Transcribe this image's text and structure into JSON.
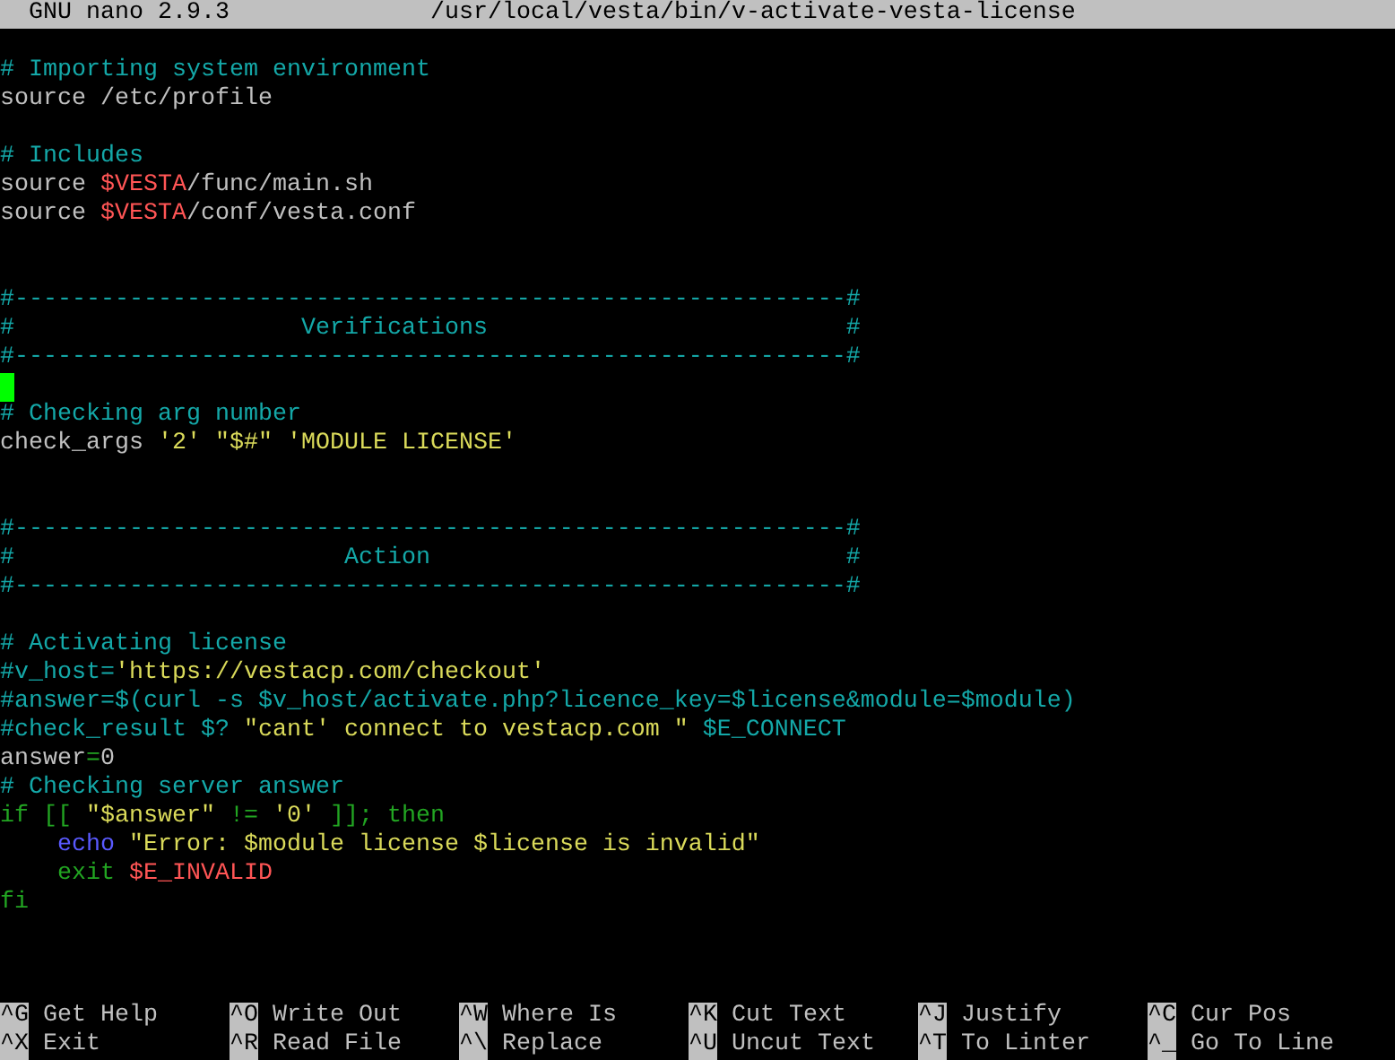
{
  "title_bar": {
    "app": "GNU nano 2.9.3",
    "file": "/usr/local/vesta/bin/v-activate-vesta-license"
  },
  "lines": [
    {
      "kind": "blank"
    },
    {
      "kind": "code",
      "segments": [
        {
          "text": "# Importing system environment",
          "kind": "comment"
        }
      ]
    },
    {
      "kind": "code",
      "segments": [
        {
          "text": "source /etc/profile",
          "kind": "plain"
        }
      ]
    },
    {
      "kind": "blank"
    },
    {
      "kind": "code",
      "segments": [
        {
          "text": "# Includes",
          "kind": "comment"
        }
      ]
    },
    {
      "kind": "code",
      "segments": [
        {
          "text": "source ",
          "kind": "plain"
        },
        {
          "text": "$VESTA",
          "kind": "variable"
        },
        {
          "text": "/func/main.sh",
          "kind": "plain"
        }
      ]
    },
    {
      "kind": "code",
      "segments": [
        {
          "text": "source ",
          "kind": "plain"
        },
        {
          "text": "$VESTA",
          "kind": "variable"
        },
        {
          "text": "/conf/vesta.conf",
          "kind": "plain"
        }
      ]
    },
    {
      "kind": "blank"
    },
    {
      "kind": "blank"
    },
    {
      "kind": "code",
      "segments": [
        {
          "text": "#----------------------------------------------------------#",
          "kind": "comment"
        }
      ]
    },
    {
      "kind": "code",
      "segments": [
        {
          "text": "#                    Verifications                         #",
          "kind": "comment"
        }
      ]
    },
    {
      "kind": "code",
      "segments": [
        {
          "text": "#----------------------------------------------------------#",
          "kind": "comment"
        }
      ]
    },
    {
      "kind": "cursor"
    },
    {
      "kind": "code",
      "segments": [
        {
          "text": "# Checking arg number",
          "kind": "comment"
        }
      ]
    },
    {
      "kind": "code",
      "segments": [
        {
          "text": "check_args ",
          "kind": "plain"
        },
        {
          "text": "'2' \"$#\" 'MODULE LICENSE'",
          "kind": "string"
        }
      ]
    },
    {
      "kind": "blank"
    },
    {
      "kind": "blank"
    },
    {
      "kind": "code",
      "segments": [
        {
          "text": "#----------------------------------------------------------#",
          "kind": "comment"
        }
      ]
    },
    {
      "kind": "code",
      "segments": [
        {
          "text": "#                       Action                             #",
          "kind": "comment"
        }
      ]
    },
    {
      "kind": "code",
      "segments": [
        {
          "text": "#----------------------------------------------------------#",
          "kind": "comment"
        }
      ]
    },
    {
      "kind": "blank"
    },
    {
      "kind": "code",
      "segments": [
        {
          "text": "# Activating license",
          "kind": "comment"
        }
      ]
    },
    {
      "kind": "code",
      "segments": [
        {
          "text": "#v_host=",
          "kind": "comment"
        },
        {
          "text": "'https://vestacp.com/checkout'",
          "kind": "string"
        }
      ]
    },
    {
      "kind": "code",
      "segments": [
        {
          "text": "#answer=$(curl -s $v_host/activate.php?licence_key=$license&module=$module)",
          "kind": "comment"
        }
      ]
    },
    {
      "kind": "code",
      "segments": [
        {
          "text": "#check_result $? ",
          "kind": "comment"
        },
        {
          "text": "\"cant' connect to vestacp.com \"",
          "kind": "string"
        },
        {
          "text": " $E_CONNECT",
          "kind": "comment"
        }
      ]
    },
    {
      "kind": "code",
      "segments": [
        {
          "text": "answer",
          "kind": "plain"
        },
        {
          "text": "=",
          "kind": "keyword"
        },
        {
          "text": "0",
          "kind": "plain"
        }
      ]
    },
    {
      "kind": "code",
      "segments": [
        {
          "text": "# Checking server answer",
          "kind": "comment"
        }
      ]
    },
    {
      "kind": "code",
      "segments": [
        {
          "text": "if [[ ",
          "kind": "keyword"
        },
        {
          "text": "\"$answer\"",
          "kind": "string"
        },
        {
          "text": " != ",
          "kind": "keyword"
        },
        {
          "text": "'0'",
          "kind": "string"
        },
        {
          "text": " ]]; then",
          "kind": "keyword"
        }
      ]
    },
    {
      "kind": "code",
      "segments": [
        {
          "text": "    echo",
          "kind": "builtin"
        },
        {
          "text": " \"Error: $module license $license is invalid\"",
          "kind": "string"
        }
      ]
    },
    {
      "kind": "code",
      "segments": [
        {
          "text": "    exit",
          "kind": "keyword"
        },
        {
          "text": " $E_INVALID",
          "kind": "variable"
        }
      ]
    },
    {
      "kind": "code",
      "segments": [
        {
          "text": "fi",
          "kind": "keyword"
        }
      ]
    }
  ],
  "shortcuts": [
    [
      {
        "key": "^G",
        "label": "Get Help"
      },
      {
        "key": "^O",
        "label": "Write Out"
      },
      {
        "key": "^W",
        "label": "Where Is"
      },
      {
        "key": "^K",
        "label": "Cut Text"
      },
      {
        "key": "^J",
        "label": "Justify"
      },
      {
        "key": "^C",
        "label": "Cur Pos"
      }
    ],
    [
      {
        "key": "^X",
        "label": "Exit"
      },
      {
        "key": "^R",
        "label": "Read File"
      },
      {
        "key": "^\\",
        "label": "Replace"
      },
      {
        "key": "^U",
        "label": "Uncut Text"
      },
      {
        "key": "^T",
        "label": "To Linter"
      },
      {
        "key": "^_",
        "label": "Go To Line"
      }
    ]
  ]
}
